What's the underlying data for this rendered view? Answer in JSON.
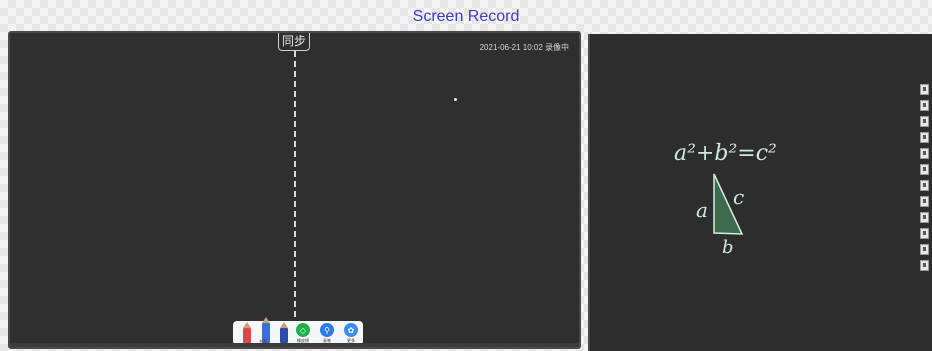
{
  "header": {
    "title": "Screen Record"
  },
  "left_screen": {
    "sync_label": "同步",
    "timestamp": "2021-06-21 10:02 录像中",
    "toolbar": {
      "pencil_label": "书写",
      "tools": [
        {
          "label": "橡皮擦",
          "color": "#22b04a",
          "icon": "eraser-icon"
        },
        {
          "label": "画笔",
          "color": "#2f7be6",
          "icon": "user-icon"
        },
        {
          "label": "更多",
          "color": "#3a8ef0",
          "icon": "settings-icon"
        }
      ]
    }
  },
  "right_screen": {
    "equation": "a²+b²=c²",
    "triangle_labels": {
      "a": "a",
      "b": "b",
      "c": "c"
    },
    "side_tools": [
      "tool-1",
      "tool-2",
      "tool-3",
      "tool-4",
      "tool-5",
      "tool-6",
      "tool-7",
      "tool-8",
      "tool-9",
      "tool-10",
      "tool-11",
      "tool-12"
    ]
  },
  "colors": {
    "board": "#2f2f2f",
    "ink": "#cfe8dc",
    "triangle_fill": "#3e6a4e",
    "title": "#3d3dbf"
  }
}
